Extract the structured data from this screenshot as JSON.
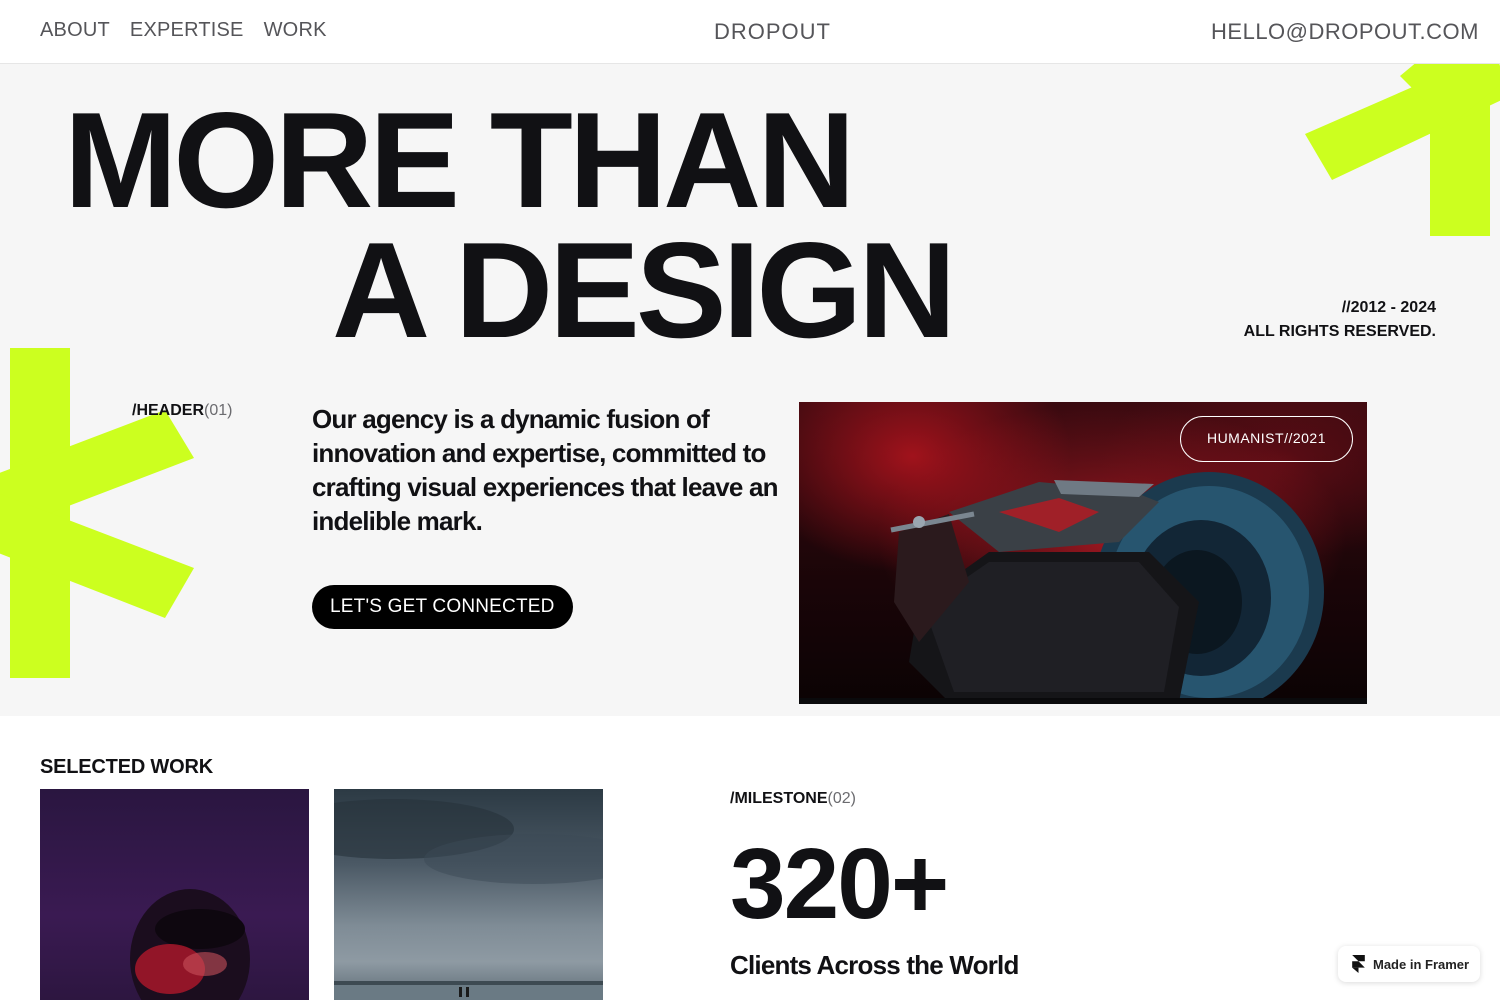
{
  "nav": {
    "links": [
      "ABOUT",
      "EXPERTISE",
      "WORK"
    ],
    "brand": "DROPOUT",
    "email": "HELLO@DROPOUT.COM"
  },
  "hero": {
    "headline_line1": "MORE THAN",
    "headline_line2": "A DESIGN",
    "years": "//2012 - 2024",
    "rights": "ALL RIGHTS RESERVED.",
    "section_label": "/HEADER",
    "section_num": "(01)",
    "intro": "Our agency is a dynamic fusion of innovation and expertise, committed to crafting visual experiences that leave an indelible mark.",
    "cta": "LET'S GET CONNECTED",
    "image_badge": "HUMANIST//2021"
  },
  "selected_work": {
    "title": "SELECTED WORK"
  },
  "milestone": {
    "label": "/MILESTONE",
    "num": "(02)",
    "value": "320+",
    "caption": "Clients Across the World"
  },
  "framer_badge": "Made in Framer",
  "colors": {
    "accent": "#CCFF1F",
    "text": "#111114",
    "nav_text": "#555559",
    "hero_bg": "#F6F6F6",
    "button_bg": "#000000"
  },
  "icons": [
    "asterisk-shape-icon",
    "framer-logo-icon"
  ]
}
